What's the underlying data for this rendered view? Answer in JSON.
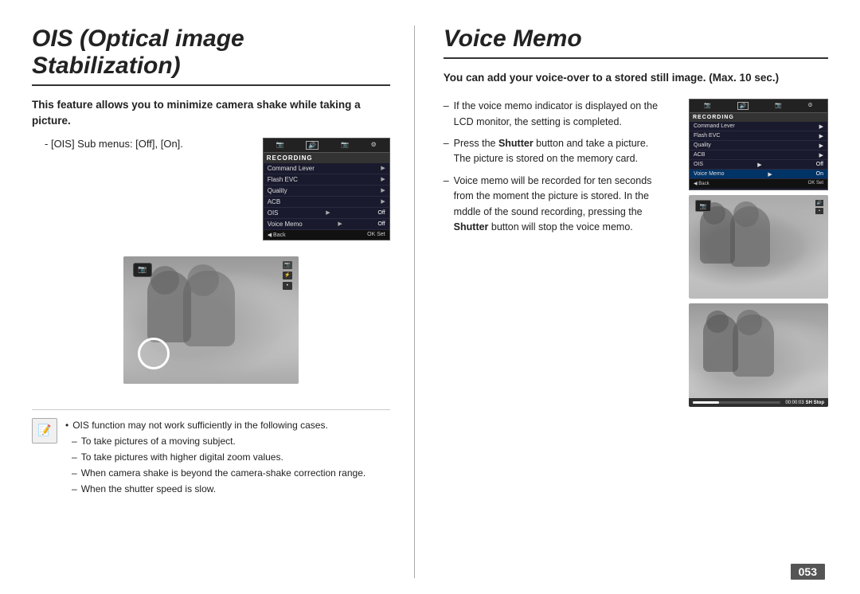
{
  "left": {
    "title": "OIS (Optical image Stabilization)",
    "intro": "This feature allows you to minimize camera shake while taking a picture.",
    "submenu_label": "[OIS] Sub menus: [Off], [On].",
    "camera_menu": {
      "tabs": [
        "📷",
        "🔊",
        "📷",
        "⚙"
      ],
      "section_label": "RECORDING",
      "rows": [
        {
          "label": "Command Lever",
          "value": "",
          "arrow": true
        },
        {
          "label": "Flash EVC",
          "value": "",
          "arrow": true
        },
        {
          "label": "Quality",
          "value": "",
          "arrow": true
        },
        {
          "label": "ACB",
          "value": "",
          "arrow": true
        },
        {
          "label": "OIS",
          "value": "Off",
          "arrow": true,
          "highlight": false
        },
        {
          "label": "Voice Memo",
          "value": "Off",
          "arrow": true,
          "highlight": false
        }
      ],
      "back_label": "Back",
      "ok_label": "Set"
    },
    "note": {
      "bullet": "OIS function may not work sufficiently in the following cases.",
      "dashes": [
        "To take pictures of a moving subject.",
        "To take pictures with higher digital zoom values.",
        "When camera shake is beyond the camera-shake correction range.",
        "When the shutter speed is slow."
      ]
    }
  },
  "right": {
    "title": "Voice Memo",
    "intro": "You can add your voice-over to a stored still image. (Max. 10 sec.)",
    "right_menu": {
      "section_label": "RECORDING",
      "rows": [
        {
          "label": "Command Lever",
          "value": "",
          "arrow": true
        },
        {
          "label": "Flash EVC",
          "value": "",
          "arrow": true
        },
        {
          "label": "Quality",
          "value": "",
          "arrow": true
        },
        {
          "label": "ACB",
          "value": "",
          "arrow": true
        },
        {
          "label": "OIS",
          "value": "Off",
          "arrow": true
        },
        {
          "label": "Voice Memo",
          "value": "On",
          "arrow": true,
          "highlight": true
        }
      ],
      "back_label": "Back",
      "ok_label": "Set"
    },
    "bullets": [
      {
        "text": "If the voice memo indicator is displayed on the LCD monitor, the setting is completed."
      },
      {
        "text_parts": [
          "Press the ",
          "Shutter",
          " button and take a picture. The picture is stored on the memory card."
        ]
      },
      {
        "text_parts": [
          "Voice memo will be recorded for ten seconds from the moment the picture is stored. In the mddle of the sound recording, pressing the ",
          "Shutter",
          " button will stop the voice memo."
        ]
      }
    ],
    "bottom_image": {
      "time": "00:00:03",
      "sh_label": "SH",
      "stop_label": "Stop"
    }
  },
  "page_number": "053"
}
